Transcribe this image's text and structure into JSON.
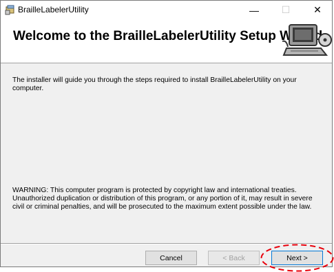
{
  "window": {
    "title": "BrailleLabelerUtility",
    "app_icon": "installer-package-icon",
    "controls": {
      "minimize": "—",
      "maximize": "☐",
      "close": "✕"
    }
  },
  "banner": {
    "title": "Welcome to the BrailleLabelerUtility Setup Wizard",
    "image": "computer-setup-icon"
  },
  "content": {
    "intro": "The installer will guide you through the steps required to install BrailleLabelerUtility on your computer.",
    "warning": "WARNING: This computer program is protected by copyright law and international treaties. Unauthorized duplication or distribution of this program, or any portion of it, may result in severe civil or criminal penalties, and will be prosecuted to the maximum extent possible under the law."
  },
  "buttons": {
    "cancel": "Cancel",
    "back": "< Back",
    "next": "Next >"
  },
  "annotation": {
    "color": "#e8000b",
    "style": "dashed-ellipse"
  }
}
